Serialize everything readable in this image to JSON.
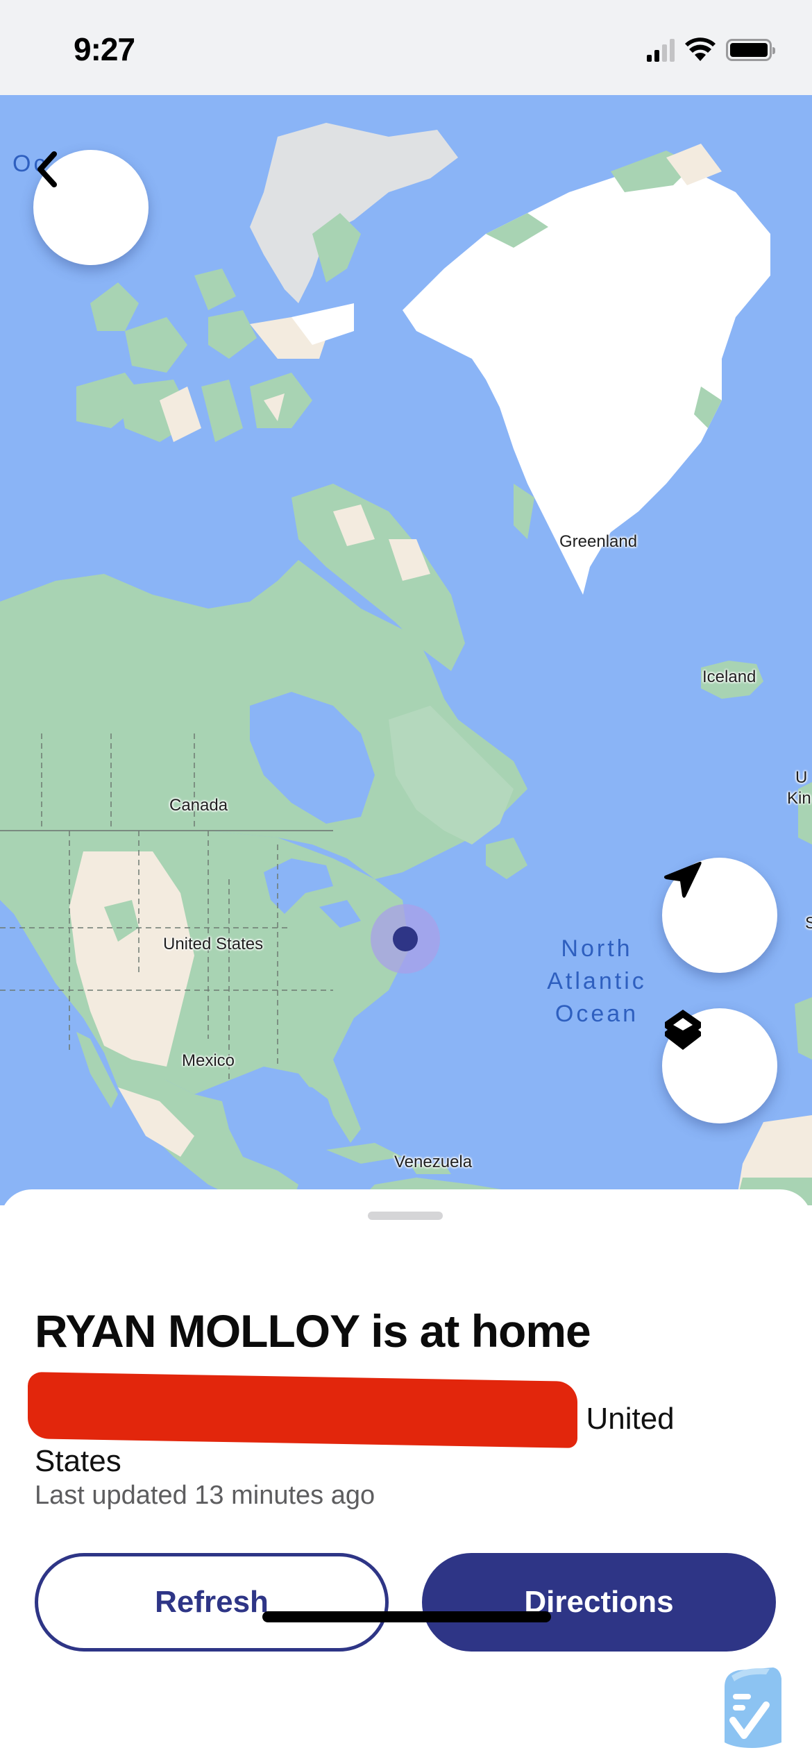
{
  "status_bar": {
    "time": "9:27",
    "signal_bars_active": 2,
    "signal_bars_total": 4,
    "wifi_icon": "wifi-icon",
    "battery_icon": "battery-full-icon"
  },
  "map": {
    "labels": {
      "greenland": "Greenland",
      "iceland": "Iceland",
      "canada": "Canada",
      "united_states": "United States",
      "mexico": "Mexico",
      "venezuela": "Venezuela",
      "uk_partial_1": "U",
      "uk_partial_2": "Kin",
      "spain_partial": "S",
      "ocean_corner_partial": "Oc"
    },
    "ocean_label": {
      "line1": "North",
      "line2": "Atlantic",
      "line3": "Ocean"
    },
    "colors": {
      "water": "#8ab4f6",
      "land": "#a8dab5",
      "ice": "#ffffff",
      "desert": "#f5ede0",
      "location_dot": "#2e3586",
      "location_halo": "#a8a0e8"
    },
    "controls": {
      "back_icon": "chevron-left-icon",
      "recenter_icon": "navigation-arrow-icon",
      "layers_icon": "layers-icon"
    }
  },
  "sheet": {
    "title": "RYAN MOLLOY is at home",
    "address_visible_suffix": ", United States",
    "address_redacted": true,
    "last_updated": "Last updated 13 minutes ago",
    "refresh_label": "Refresh",
    "directions_label": "Directions",
    "brand_color": "#2e3586",
    "redaction_color": "#e2260c"
  }
}
